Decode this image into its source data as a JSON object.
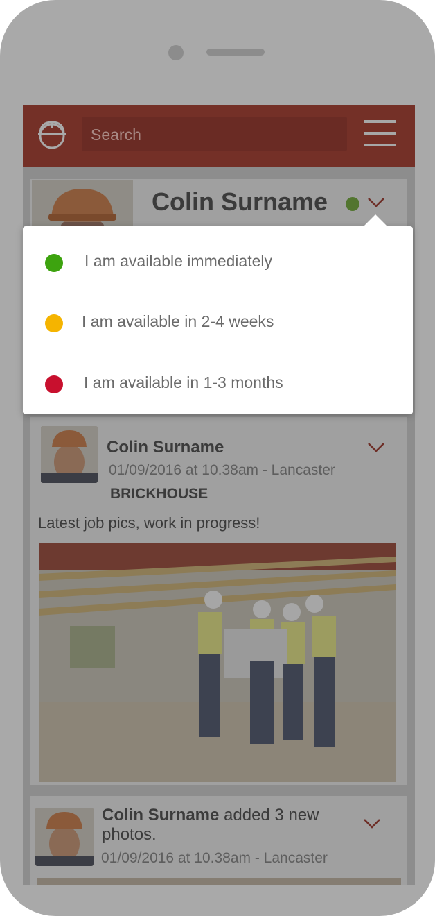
{
  "search": {
    "placeholder": "Search"
  },
  "profile": {
    "name": "Colin Surname",
    "status_color": "#52752f"
  },
  "availability": {
    "options": [
      {
        "label": "I am available immediately",
        "color": "#3da30f"
      },
      {
        "label": "I am available in 2-4 weeks",
        "color": "#f5b400"
      },
      {
        "label": "I am available in 1-3 months",
        "color": "#c8102e"
      }
    ]
  },
  "feed": {
    "posts": [
      {
        "author": "Colin Surname",
        "meta": "01/09/2016 at 10.38am - Lancaster",
        "company": "BRICKHOUSE",
        "text": "Latest job pics, work in progress!"
      },
      {
        "author": "Colin Surname",
        "action": " added 3 new photos.",
        "meta": "01/09/2016 at 10.38am - Lancaster"
      }
    ]
  },
  "colors": {
    "brand": "#743027",
    "accent": "#a8342c"
  }
}
